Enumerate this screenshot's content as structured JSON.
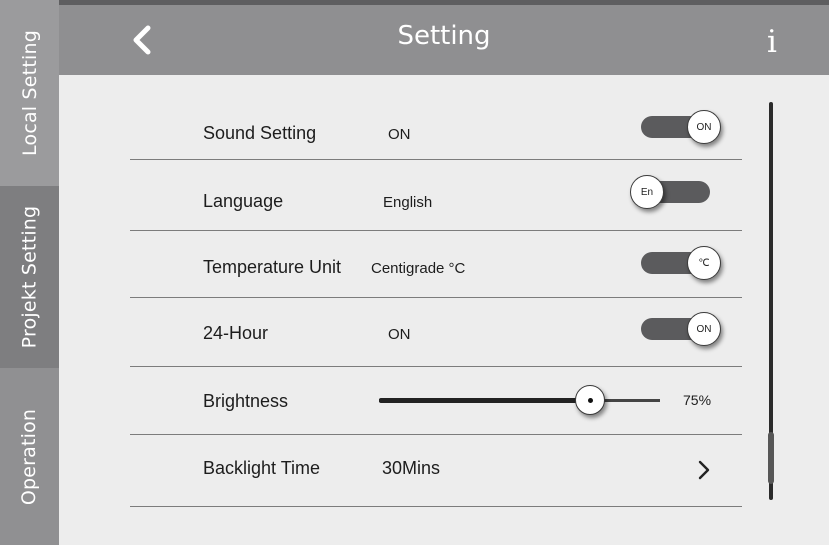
{
  "sidebar": {
    "tabs": [
      {
        "label": "Local Setting",
        "active": true
      },
      {
        "label": "Projekt Setting",
        "active": false
      },
      {
        "label": "Operation",
        "active": false
      }
    ]
  },
  "header": {
    "title": "Setting",
    "back_icon": "chevron-left-icon",
    "info_icon": "info-icon",
    "info_glyph": "i"
  },
  "settings": {
    "sound": {
      "label": "Sound Setting",
      "value": "ON",
      "toggle_text": "ON",
      "toggle_state": "on"
    },
    "language": {
      "label": "Language",
      "value": "English",
      "toggle_text": "En",
      "toggle_state": "off"
    },
    "temperature": {
      "label": "Temperature Unit",
      "value": "Centigrade °C",
      "toggle_text": "℃",
      "toggle_state": "on"
    },
    "hour24": {
      "label": "24-Hour",
      "value": "ON",
      "toggle_text": "ON",
      "toggle_state": "on"
    },
    "brightness": {
      "label": "Brightness",
      "value_text": "75%",
      "level": 0.75
    },
    "backlight": {
      "label": "Backlight Time",
      "value": "30Mins",
      "chevron_icon": "chevron-right-icon"
    }
  },
  "colors": {
    "header_bg": "#8f8f91",
    "sidebar_bg": "#8d8d8f",
    "toggle_track": "#5b5b5d",
    "content_bg": "#ededed"
  }
}
